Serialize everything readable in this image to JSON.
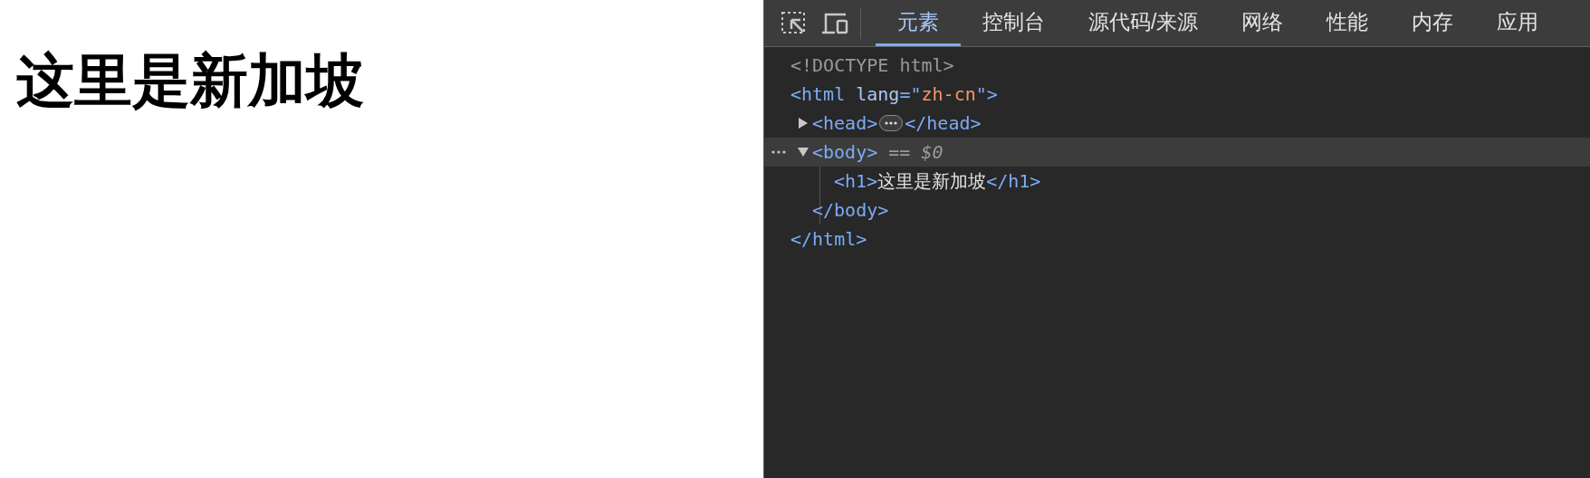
{
  "page": {
    "heading": "这里是新加坡"
  },
  "devtools": {
    "tabs": [
      {
        "label": "元素",
        "selected": true
      },
      {
        "label": "控制台",
        "selected": false
      },
      {
        "label": "源代码/来源",
        "selected": false
      },
      {
        "label": "网络",
        "selected": false
      },
      {
        "label": "性能",
        "selected": false
      },
      {
        "label": "内存",
        "selected": false
      },
      {
        "label": "应用",
        "selected": false
      }
    ],
    "elements_tree": [
      {
        "kind": "doctype",
        "selected": false,
        "tokens": [
          {
            "kind": "doctype",
            "text": "<!DOCTYPE html>"
          }
        ]
      },
      {
        "kind": "element",
        "selected": false,
        "tokens": [
          {
            "kind": "tag",
            "text": "<html "
          },
          {
            "kind": "attr-name",
            "text": "lang"
          },
          {
            "kind": "tag",
            "text": "=\""
          },
          {
            "kind": "attr-value",
            "text": "zh-cn"
          },
          {
            "kind": "tag",
            "text": "\">"
          }
        ],
        "closing": [
          {
            "kind": "tag",
            "text": "</html>"
          }
        ],
        "children": [
          {
            "kind": "element",
            "selected": false,
            "expanded": false,
            "tokens": [
              {
                "kind": "tag",
                "text": "<head>"
              }
            ],
            "closing": [
              {
                "kind": "tag",
                "text": "</head>"
              }
            ]
          },
          {
            "kind": "element",
            "selected": true,
            "expanded": true,
            "tokens": [
              {
                "kind": "tag",
                "text": "<body>"
              },
              {
                "kind": "ref",
                "text": " == "
              },
              {
                "kind": "ref-italic",
                "text": "$0"
              }
            ],
            "closing": [
              {
                "kind": "tag",
                "text": "</body>"
              }
            ],
            "children": [
              {
                "kind": "element",
                "selected": false,
                "tokens": [
                  {
                    "kind": "tag",
                    "text": "<h1>"
                  },
                  {
                    "kind": "text",
                    "text": "这里是新加坡"
                  },
                  {
                    "kind": "tag",
                    "text": "</h1>"
                  }
                ]
              }
            ]
          }
        ]
      }
    ]
  }
}
